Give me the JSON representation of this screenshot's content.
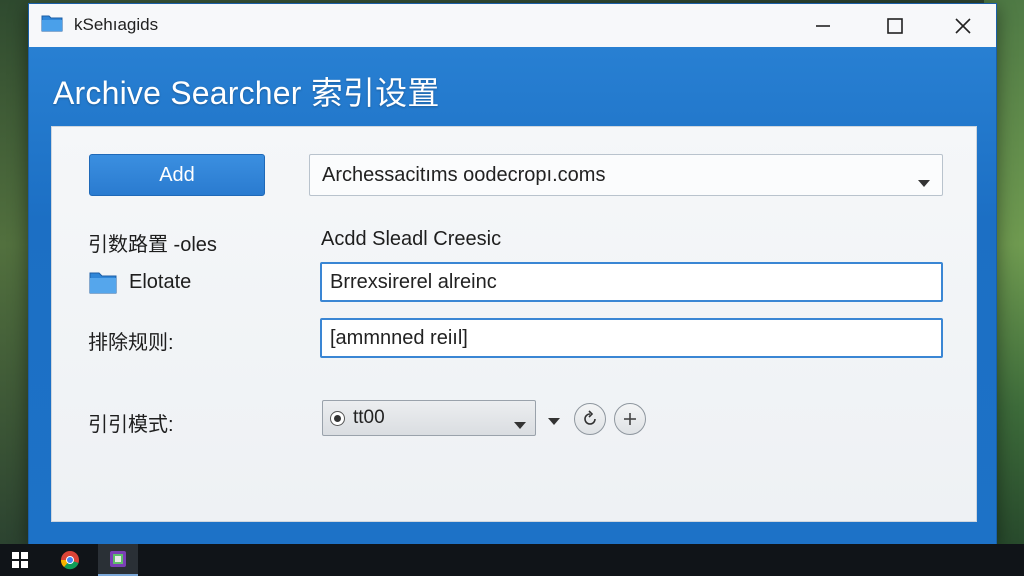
{
  "window": {
    "title": "kSehıagids"
  },
  "header": {
    "title": "Archive Searcher 索引设置"
  },
  "panel": {
    "add_button": "Add",
    "source_combo_value": "Archessacitıms oodecropı.coms",
    "index_path_label": "引数路置 -oles",
    "right_label": "Acdd Sleadl Creesic",
    "folder_label": "Elotate",
    "folder_field_value": "Brrexsirerel alreinc",
    "exclude_label": "排除规则:",
    "exclude_field_value": "[ammnned reiıl]",
    "mode_label": "引引模式:",
    "mode_select_value": "tt00"
  },
  "icons": {
    "app": "folder-icon",
    "minimize": "minimize-icon",
    "maximize": "maximize-icon",
    "close": "close-icon",
    "folder": "folder-icon",
    "refresh": "refresh-icon",
    "add": "plus-icon",
    "start": "windows-start-icon",
    "browser": "chrome-icon",
    "taskbar_app": "app-icon"
  },
  "colors": {
    "window_accent": "#1c6fc4",
    "field_border": "#3a86d4",
    "button_primary": "#2a7bd0"
  }
}
